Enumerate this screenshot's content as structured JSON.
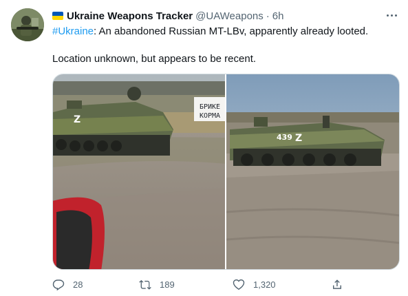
{
  "tweet": {
    "author_name": "Ukraine Weapons Tracker",
    "handle": "@UAWeapons",
    "separator": "·",
    "time": "6h",
    "hashtag": "#Ukraine",
    "text_line1": ": An abandoned Russian MT-LBv, apparently already looted.",
    "text_line2": "Location unknown, but appears to be recent."
  },
  "media": {
    "sign_line1": "БРИКЕ",
    "sign_line2": "КОРМА",
    "left_vehicle_mark": "Z",
    "right_vehicle_number": "439",
    "right_vehicle_mark": "Z"
  },
  "actions": {
    "replies": "28",
    "retweets": "189",
    "likes": "1,320"
  },
  "colors": {
    "accent": "#1d9bf0",
    "text_primary": "#0f1419",
    "text_secondary": "#536471",
    "flag_blue": "#0057b7",
    "flag_yellow": "#ffd700"
  },
  "icons": [
    "ukraine-flag-icon",
    "more-icon",
    "reply-icon",
    "retweet-icon",
    "like-icon",
    "share-icon"
  ]
}
